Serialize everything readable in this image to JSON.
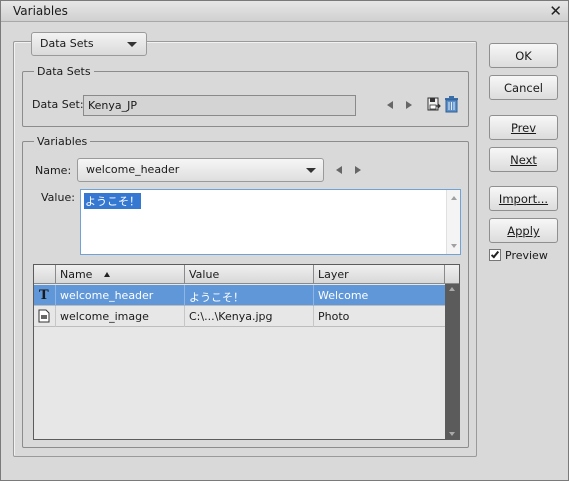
{
  "window": {
    "title": "Variables"
  },
  "mode_dropdown": {
    "value": "Data Sets"
  },
  "data_sets": {
    "legend": "Data Sets",
    "label": "Data Set:",
    "value": "Kenya_JP"
  },
  "variables": {
    "legend": "Variables",
    "name_label": "Name:",
    "name_value": "welcome_header",
    "value_label": "Value:",
    "value_text": "ようこそ！"
  },
  "table": {
    "columns": [
      "Name",
      "Value",
      "Layer"
    ],
    "rows": [
      {
        "icon": "text-icon",
        "name": "welcome_header",
        "value": "ようこそ！",
        "layer": "Welcome",
        "selected": true
      },
      {
        "icon": "image-icon",
        "name": "welcome_image",
        "value": "C:\\...\\Kenya.jpg",
        "layer": "Photo",
        "selected": false
      }
    ]
  },
  "buttons": {
    "ok": "OK",
    "cancel": "Cancel",
    "prev": "Prev",
    "next": "Next",
    "import": "Import...",
    "apply": "Apply"
  },
  "preview": {
    "label": "Preview",
    "checked": true
  },
  "colors": {
    "selection": "#5f97d8",
    "value_highlight": "#3578d2"
  }
}
